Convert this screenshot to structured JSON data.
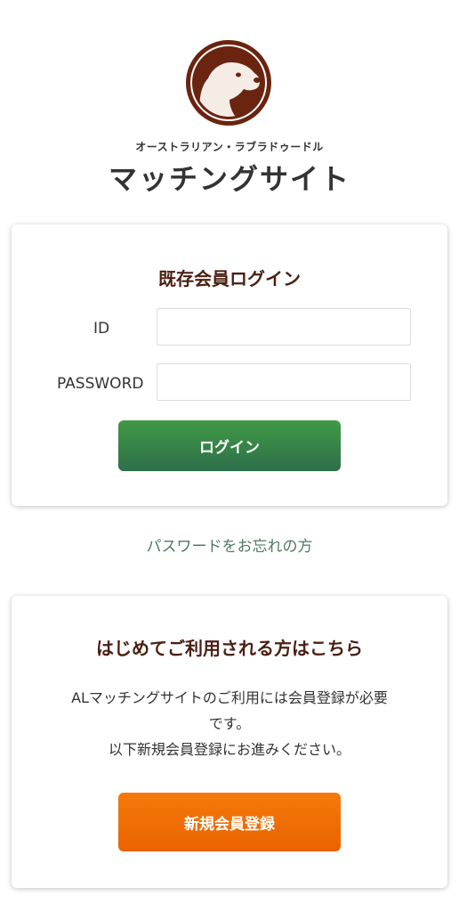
{
  "header": {
    "subtitle": "オーストラリアン・ラブラドゥードル",
    "title": "マッチングサイト",
    "logo_icon": "dog-head-icon",
    "brand_color": "#6b2410"
  },
  "login": {
    "heading": "既存会員ログイン",
    "id_label": "ID",
    "id_value": "",
    "password_label": "PASSWORD",
    "password_value": "",
    "button_label": "ログイン"
  },
  "forgot_link": "パスワードをお忘れの方",
  "register": {
    "heading": "はじめてご利用される方はこちら",
    "desc_line1": "ALマッチングサイトのご利用には会員登録が必要",
    "desc_line2": "です。",
    "desc_line3": "以下新規会員登録にお進みください。",
    "button_label": "新規会員登録"
  }
}
